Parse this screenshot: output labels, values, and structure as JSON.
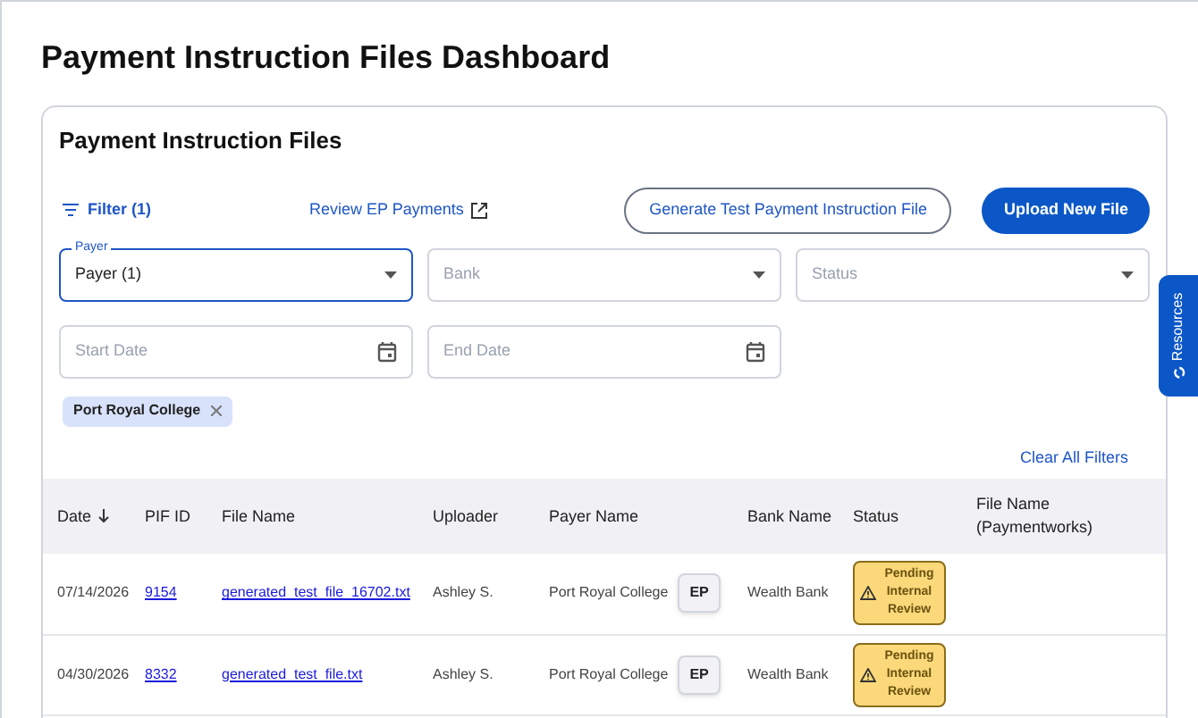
{
  "page_title": "Payment Instruction Files Dashboard",
  "card_title": "Payment Instruction Files",
  "filter_button": "Filter (1)",
  "review_link": "Review EP Payments",
  "generate_button": "Generate Test Payment Instruction File",
  "upload_button": "Upload New File",
  "selects": [
    {
      "label": "Payer",
      "value": "Payer (1)",
      "focused": true
    },
    {
      "placeholder": "Bank",
      "focused": false
    },
    {
      "placeholder": "Status",
      "focused": false
    }
  ],
  "date_fields": [
    {
      "placeholder": "Start Date"
    },
    {
      "placeholder": "End Date"
    }
  ],
  "chips": [
    {
      "label": "Port Royal College"
    }
  ],
  "clear_filters": "Clear All Filters",
  "table": {
    "columns": [
      {
        "label": "Date",
        "sorted": true
      },
      {
        "label": "PIF ID",
        "sorted": false
      },
      {
        "label": "File Name",
        "sorted": false
      },
      {
        "label": "Uploader",
        "sorted": false
      },
      {
        "label": "Payer Name",
        "sorted": false
      },
      {
        "label": "Bank Name",
        "sorted": false
      },
      {
        "label": "Status",
        "sorted": false
      },
      {
        "label": "File Name (Paymentworks)",
        "sorted": false
      }
    ],
    "rows": [
      {
        "date": "07/14/2026",
        "pif_id": "9154",
        "file_name": "generated_test_file_16702.txt",
        "uploader": "Ashley S.",
        "payer": "Port Royal College",
        "payer_tag": "EP",
        "bank": "Wealth Bank",
        "status": "Pending Internal Review"
      },
      {
        "date": "04/30/2026",
        "pif_id": "8332",
        "file_name": "generated_test_file.txt",
        "uploader": "Ashley S.",
        "payer": "Port Royal College",
        "payer_tag": "EP",
        "bank": "Wealth Bank",
        "status": "Pending Internal Review"
      }
    ]
  },
  "resources_tab": "Resources"
}
